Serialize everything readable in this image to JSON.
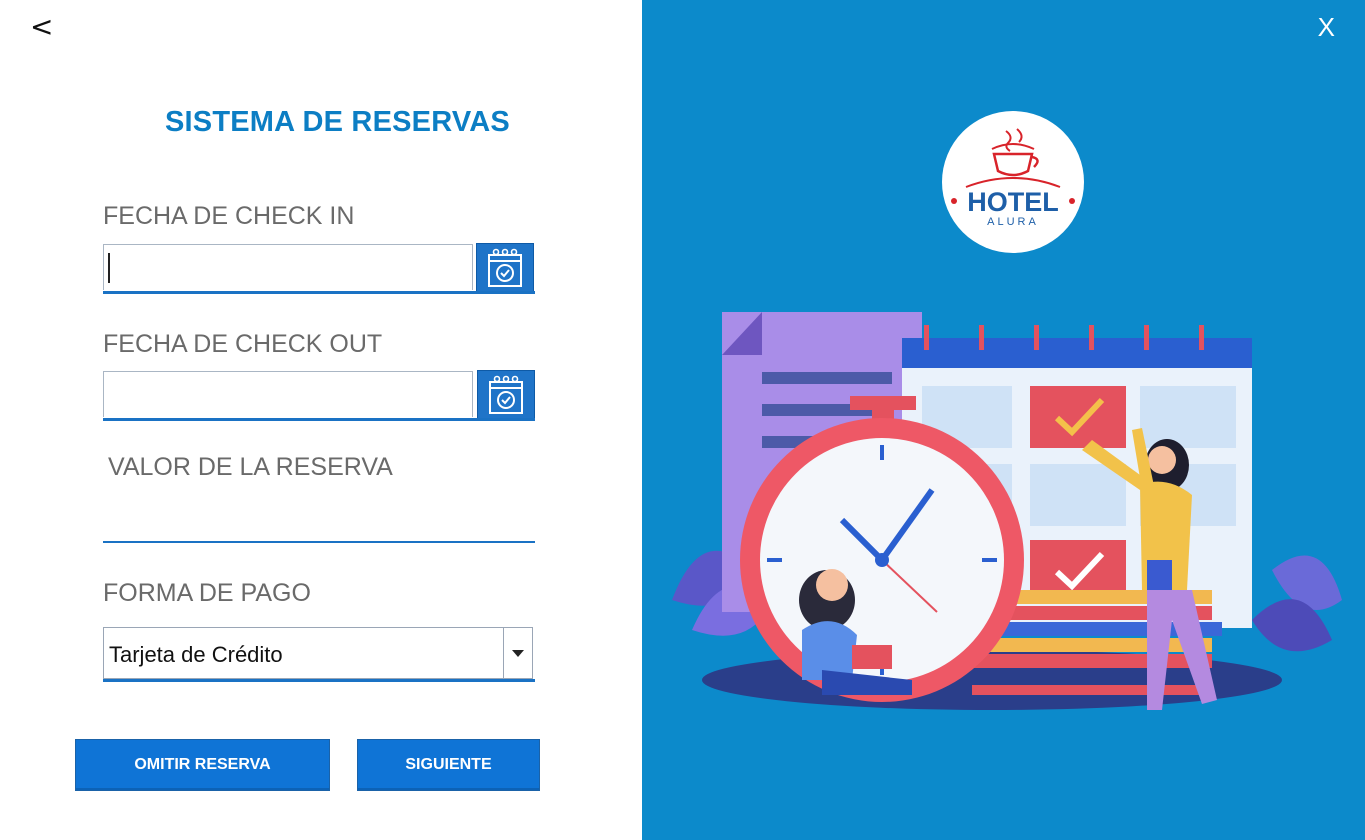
{
  "nav": {
    "back_label": "<",
    "close_label": "X"
  },
  "form": {
    "title": "SISTEMA DE RESERVAS",
    "checkin": {
      "label": "FECHA DE CHECK IN",
      "value": ""
    },
    "checkout": {
      "label": "FECHA DE CHECK OUT",
      "value": ""
    },
    "valor": {
      "label": "VALOR DE LA RESERVA",
      "value": ""
    },
    "pago": {
      "label": "FORMA DE PAGO",
      "selected": "Tarjeta de Crédito"
    }
  },
  "buttons": {
    "omitir_label": "OMITIR RESERVA",
    "siguiente_label": "SIGUIENTE"
  },
  "logo": {
    "line1": "HOTEL",
    "line2": "ALURA"
  },
  "colors": {
    "accent": "#0c8acb",
    "title": "#0c7ec4",
    "button": "#0f74d6",
    "underline": "#1a72c4"
  },
  "icons": {
    "back": "chevron-left-icon",
    "close": "close-icon",
    "calendar": "calendar-check-icon",
    "dropdown": "chevron-down-icon"
  }
}
